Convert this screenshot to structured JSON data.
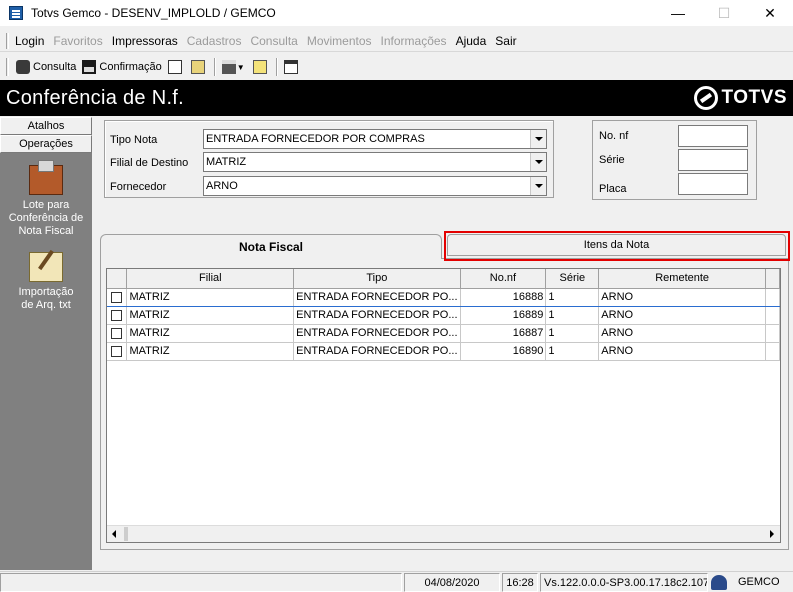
{
  "window": {
    "title": "Totvs Gemco - DESENV_IMPLOLD / GEMCO",
    "icon": "app-icon",
    "controls": {
      "minimize": "—",
      "maximize": "☐",
      "close": "✕"
    }
  },
  "menu": {
    "items": [
      {
        "label": "Login",
        "enabled": true
      },
      {
        "label": "Favoritos",
        "enabled": false
      },
      {
        "label": "Impressoras",
        "enabled": true
      },
      {
        "label": "Cadastros",
        "enabled": false
      },
      {
        "label": "Consulta",
        "enabled": false
      },
      {
        "label": "Movimentos",
        "enabled": false
      },
      {
        "label": "Informações",
        "enabled": false
      },
      {
        "label": "Ajuda",
        "enabled": true
      },
      {
        "label": "Sair",
        "enabled": true
      }
    ]
  },
  "toolbar": {
    "consulta_label": "Consulta",
    "confirmacao_label": "Confirmação"
  },
  "header": {
    "title": "Conferência de N.f.",
    "logo_text": "TOTVS"
  },
  "sidebar": {
    "atalhos_label": "Atalhos",
    "operacoes_label": "Operações",
    "items": [
      {
        "label": "Lote para Conferência de Nota Fiscal",
        "icon": "box-icon"
      },
      {
        "label": "Importação de Arq. txt",
        "icon": "scroll-icon"
      }
    ]
  },
  "filters": {
    "tipo_nota_label": "Tipo Nota",
    "tipo_nota_value": "ENTRADA FORNECEDOR POR COMPRAS",
    "filial_label": "Filial de Destino",
    "filial_value": "MATRIZ",
    "fornecedor_label": "Fornecedor",
    "fornecedor_value": "ARNO",
    "no_nf_label": "No. nf",
    "no_nf_value": "",
    "serie_label": "Série",
    "serie_value": "",
    "placa_label": "Placa",
    "placa_value": ""
  },
  "tabs": {
    "nota_fiscal": "Nota Fiscal",
    "itens_nota": "Itens da Nota"
  },
  "grid": {
    "columns": [
      "",
      "Filial",
      "Tipo",
      "No.nf",
      "Série",
      "Remetente"
    ],
    "rows": [
      {
        "filial": "MATRIZ",
        "tipo": "ENTRADA FORNECEDOR PO...",
        "nonf": "16888",
        "serie": "1",
        "remetente": "ARNO"
      },
      {
        "filial": "MATRIZ",
        "tipo": "ENTRADA FORNECEDOR PO...",
        "nonf": "16889",
        "serie": "1",
        "remetente": "ARNO"
      },
      {
        "filial": "MATRIZ",
        "tipo": "ENTRADA FORNECEDOR PO...",
        "nonf": "16887",
        "serie": "1",
        "remetente": "ARNO"
      },
      {
        "filial": "MATRIZ",
        "tipo": "ENTRADA FORNECEDOR PO...",
        "nonf": "16890",
        "serie": "1",
        "remetente": "ARNO"
      }
    ]
  },
  "status": {
    "date": "04/08/2020",
    "time": "16:28",
    "version": "Vs.122.0.0.0-SP3.00.17.18c2.107",
    "company": "GEMCO"
  },
  "colors": {
    "header_bg": "#000000",
    "sidebar_bg": "#808080",
    "highlight": "#e30000"
  }
}
